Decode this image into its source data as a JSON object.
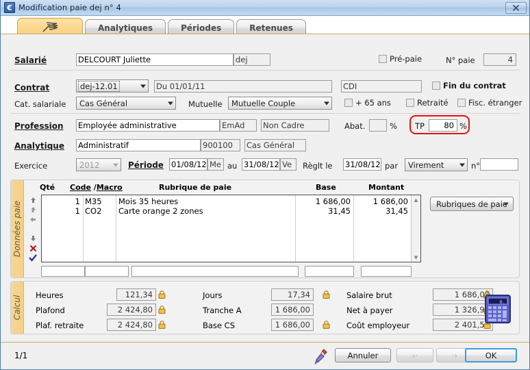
{
  "window": {
    "title": "Modification paie dej n° 4",
    "icon": "euro-app-icon",
    "close_label": "✕"
  },
  "tabs": [
    {
      "label": "",
      "icon": "feather-quill-icon",
      "active": true
    },
    {
      "label": "Analytiques",
      "active": false
    },
    {
      "label": "Périodes",
      "active": false
    },
    {
      "label": "Retenues",
      "active": false
    }
  ],
  "form": {
    "salarie": {
      "label": "Salarié",
      "name_value": "DELCOURT Juliette",
      "code_value": "dej",
      "prepaie_label": "Pré-paie",
      "prepaie_checked": false,
      "no_paie_label": "N° paie",
      "no_paie_value": "4"
    },
    "contrat": {
      "label": "Contrat",
      "combo_value": "dej-12.01",
      "date_value": "Du 01/01/11",
      "type_value": "CDI",
      "fin_label": "Fin du contrat",
      "fin_checked": false
    },
    "categorie": {
      "label": "Cat. salariale",
      "value": "Cas Général",
      "mutuelle_label": "Mutuelle",
      "mutuelle_value": "Mutuelle Couple",
      "plus65_label": "+ 65 ans",
      "plus65_checked": false,
      "retraite_label": "Retraité",
      "retraite_checked": false,
      "fisc_label": "Fisc. étranger",
      "fisc_checked": false
    },
    "profession": {
      "label": "Profession",
      "value": "Employée administrative",
      "code_value": "EmAd",
      "cadre_value": "Non Cadre",
      "abat_label": "Abat.",
      "abat_value": "",
      "abat_pct": "%",
      "tp_label": "TP",
      "tp_value": "80",
      "tp_pct": "%"
    },
    "analytique": {
      "label": "Analytique",
      "value": "Administratif",
      "code_value": "900100",
      "cas_value": "Cas Général"
    },
    "exercice": {
      "label": "Exercice",
      "value": "2012",
      "periode_label": "Période",
      "du_value": "01/08/12",
      "du_day": "Me",
      "au_label": "au",
      "au_value": "31/08/12",
      "au_day": "Ve",
      "reglt_label": "Règlt le",
      "reglt_value": "31/08/12",
      "par_label": "par",
      "mode_value": "Virement",
      "num_label": "n°",
      "num_value": ""
    }
  },
  "donnees_paie": {
    "group_label": "Données paie",
    "columns": [
      "Qté",
      "Code",
      "/",
      "Macro",
      "Rubrique de paie",
      "Base",
      "Montant"
    ],
    "col_qte": "Qté",
    "col_code": "Code",
    "col_slash": " /",
    "col_macro": "Macro",
    "col_rubrique": "Rubrique de paie",
    "col_base": "Base",
    "col_montant": "Montant",
    "rows": [
      {
        "qte": "1",
        "code": "M35",
        "rubrique": "Mois 35 heures",
        "base": "1 686,00",
        "montant": "1 686,00"
      },
      {
        "qte": "1",
        "code": "CO2",
        "rubrique": "Carte orange 2 zones",
        "base": "31,45",
        "montant": "31,45"
      }
    ],
    "side_icons": [
      "move-top-icon",
      "move-up-icon",
      "move-prev-icon",
      "move-down-icon",
      "delete-icon",
      "validate-icon"
    ],
    "rubriques_button": "Rubriques de paie",
    "entry_row": {
      "qte": "",
      "code": "",
      "rubrique": "",
      "base": "",
      "montant": ""
    }
  },
  "calcul": {
    "group_label": "Calcul",
    "fields": [
      {
        "label": "Heures",
        "value": "121,34",
        "locked": true
      },
      {
        "label": "Plafond",
        "value": "2 424,80",
        "locked": true
      },
      {
        "label": "Plaf. retraite",
        "value": "2 424,80",
        "locked": true
      },
      {
        "label": "Jours",
        "value": "17,34",
        "locked": true
      },
      {
        "label": "Tranche A",
        "value": "1 686,00",
        "locked": false
      },
      {
        "label": "Base CS",
        "value": "1 686,00",
        "locked": true
      },
      {
        "label": "Salaire brut",
        "value": "1 686,00",
        "locked": true
      },
      {
        "label": "Net à payer",
        "value": "1 326,94",
        "locked": true
      },
      {
        "label": "Coût employeur",
        "value": "2 401,51",
        "locked": true
      }
    ],
    "calculator_icon": "calculator-icon"
  },
  "statusbar": {
    "page": "1/1",
    "pen_icon": "pen-icon",
    "cancel_label": "Annuler",
    "prev_label": "‹·",
    "next_label": "·›",
    "ok_label": "OK"
  },
  "colors": {
    "accent_orange": "#f7cf84",
    "highlight_red": "#e8110f",
    "title_blue": "#a9c7e4",
    "default_button_blue": "#3c9ae0"
  }
}
